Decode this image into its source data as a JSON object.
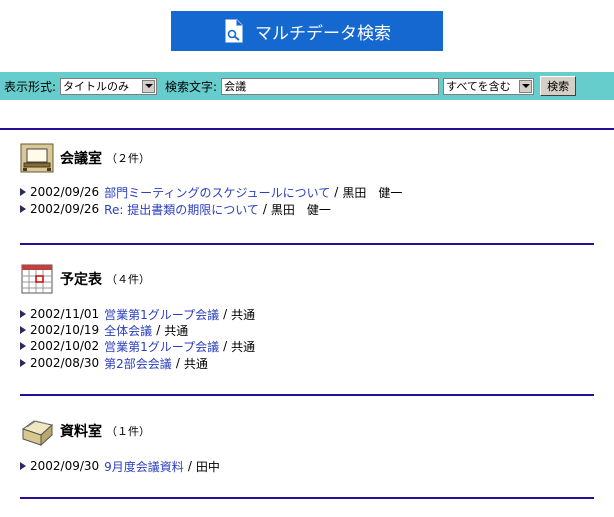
{
  "header": {
    "title": "マルチデータ検索",
    "icon": "search-document-icon"
  },
  "search": {
    "display_label": "表示形式:",
    "display_value": "タイトルのみ",
    "keyword_label": "検索文字:",
    "keyword_value": "会議",
    "match_value": "すべてを含む",
    "button_label": "検索"
  },
  "colors": {
    "banner": "#1468d0",
    "search_bar": "#66cccc",
    "divider": "#2a0c9c",
    "link": "#2b3fbf"
  },
  "sections": [
    {
      "name": "会議室",
      "count": "（２件）",
      "icon": "meeting-room-icon",
      "items": [
        {
          "date": "2002/09/26",
          "title": "部門ミーティングのスケジュールについて",
          "author": "黒田　健一"
        },
        {
          "date": "2002/09/26",
          "title": "Re: 提出書類の期限について",
          "author": "黒田　健一"
        }
      ]
    },
    {
      "name": "予定表",
      "count": "（４件）",
      "icon": "calendar-icon",
      "items": [
        {
          "date": "2002/11/01",
          "title": "営業第1グループ会議",
          "author": "共通"
        },
        {
          "date": "2002/10/19",
          "title": "全体会議",
          "author": "共通"
        },
        {
          "date": "2002/10/02",
          "title": "営業第1グループ会議",
          "author": "共通"
        },
        {
          "date": "2002/08/30",
          "title": "第2部会会議",
          "author": "共通"
        }
      ]
    },
    {
      "name": "資料室",
      "count": "（１件）",
      "icon": "folder-icon",
      "items": [
        {
          "date": "2002/09/30",
          "title": "9月度会議資料",
          "author": "田中"
        }
      ]
    }
  ]
}
